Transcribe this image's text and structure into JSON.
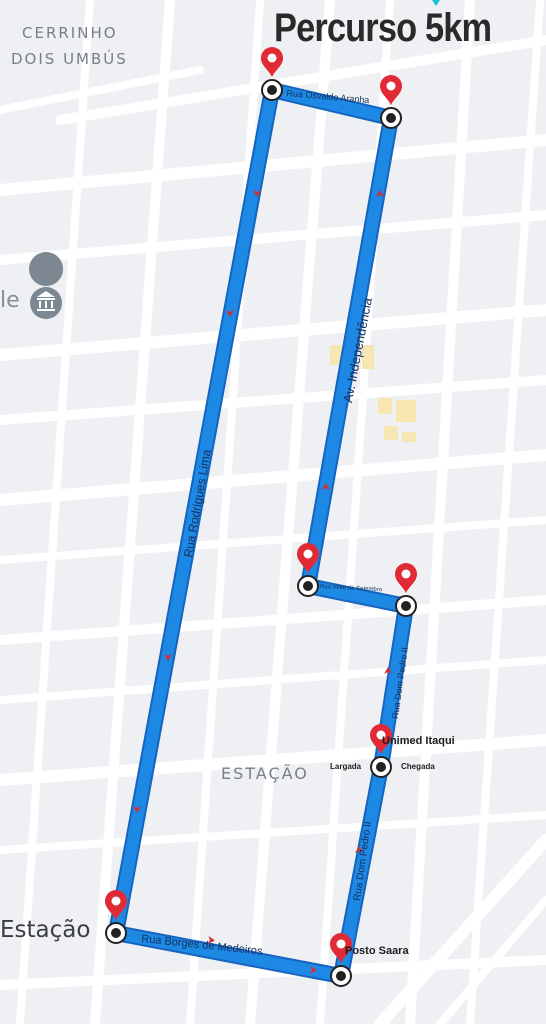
{
  "title": "Percurso 5km",
  "areas": {
    "cerrinho_line1": "CERRINHO",
    "cerrinho_line2": "DOIS UMBÚS",
    "estacao_district": "ESTAÇÃO",
    "estacao_place": "Estação",
    "cut_left_label": "le"
  },
  "streets": {
    "osvaldo_aranha": "Rua Osvaldo Aranha",
    "independencia": "Av. Independência",
    "rodrigues_lima": "Rua Rodrigues Lima",
    "vinte_setembro": "Rua Vinte de Setembro",
    "dom_pedro_upper": "Rua Dom Pedro II",
    "dom_pedro_lower": "Rua Dom Pedro II",
    "borges_medeiros": "Rua Borges de Medeiros"
  },
  "points": {
    "unimed": "Unimed Itaqui",
    "largada": "Largada",
    "chegada": "Chegada",
    "posto": "Posto Saara"
  },
  "colors": {
    "route": "#1e88e5",
    "route_outline": "#1565c0",
    "pin": "#e02b36",
    "road": "#ffffff",
    "map_bg": "#eef0f3",
    "arrow": "#d32f2f"
  },
  "icons": {
    "museum": "museum-icon",
    "pin": "map-pin-icon",
    "waypoint": "waypoint-icon"
  }
}
